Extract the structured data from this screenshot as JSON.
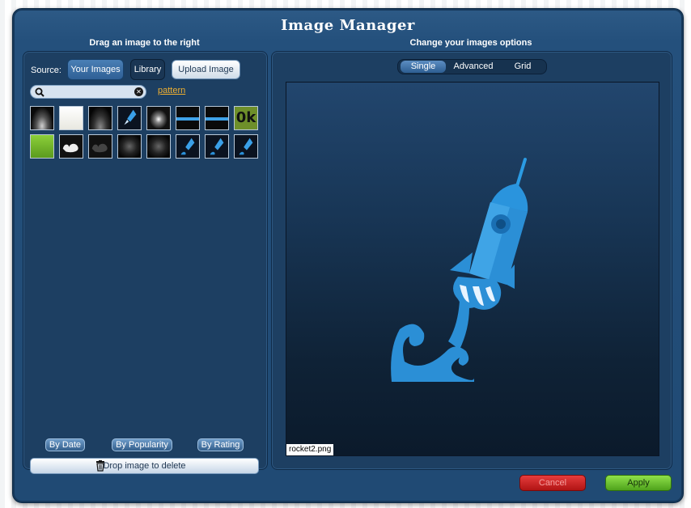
{
  "dialog": {
    "title": "Image Manager",
    "left_heading": "Drag an image to the right",
    "right_heading": "Change your images options"
  },
  "source": {
    "label": "Source:",
    "your_images": "Your Images",
    "library": "Library",
    "upload": "Upload Image"
  },
  "search": {
    "placeholder": "",
    "pattern_link": "pattern"
  },
  "thumbnails": {
    "ok_text": "0k"
  },
  "sort": {
    "by_date": "By Date",
    "by_popularity": "By Popularity",
    "by_rating": "By Rating"
  },
  "delete_zone": "Drop image to delete",
  "view_modes": {
    "single": "Single",
    "advanced": "Advanced",
    "grid": "Grid"
  },
  "preview": {
    "filename": "rocket2.png"
  },
  "actions": {
    "cancel": "Cancel",
    "apply": "Apply"
  },
  "colors": {
    "dialog_bg": "#24507c",
    "accent_blue": "#2b8fd6",
    "link_orange": "#f0b030",
    "cancel_red": "#c62828",
    "apply_green": "#6cc531"
  }
}
